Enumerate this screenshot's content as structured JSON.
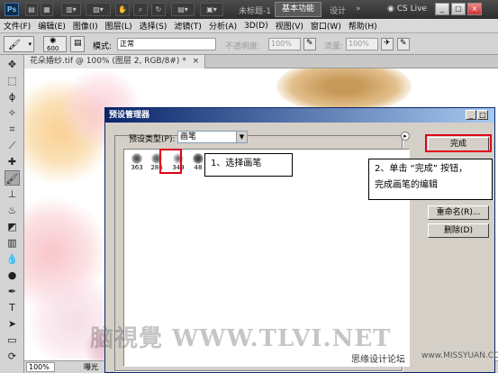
{
  "titlebar": {
    "logo": "Ps",
    "doc_title": "未标题-1",
    "workspace": "基本功能",
    "design": "设计",
    "more": "»",
    "cs_live": "CS Live",
    "minimize": "_",
    "restore": "□",
    "close": "×"
  },
  "menu": {
    "items": [
      "文件(F)",
      "编辑(E)",
      "图像(I)",
      "图层(L)",
      "选择(S)",
      "滤镜(T)",
      "分析(A)",
      "3D(D)",
      "视图(V)",
      "窗口(W)",
      "帮助(H)"
    ]
  },
  "options": {
    "brush_size": "600",
    "mode_label": "模式:",
    "mode_value": "正常",
    "opacity_label": "不透明度:",
    "opacity_value": "100%",
    "flow_label": "流量:",
    "flow_value": "100%"
  },
  "document": {
    "tab_label": "花朵婚纱.tif @ 100% (图层 2, RGB/8#) *",
    "zoom": "100%",
    "status": "曝光"
  },
  "dialog": {
    "title": "预设管理器",
    "preset_type_label": "预设类型(P):",
    "preset_type_value": "画笔",
    "buttons": {
      "done": "完成",
      "rename": "重命名(R)...",
      "delete": "删除(D)"
    },
    "brushes": [
      {
        "size": "363"
      },
      {
        "size": "286"
      },
      {
        "size": "349"
      },
      {
        "size": "48"
      }
    ]
  },
  "annotations": {
    "step1": "1、选择画笔",
    "step2_line1": "2、单击 “完成” 按钮，",
    "step2_line2": "完成画笔的编辑"
  },
  "watermarks": {
    "tlvi": "脑視覺 WWW.TLVI.NET",
    "forum": "思缘设计论坛",
    "missyuan": "www.MISSYUAN.COM"
  },
  "colors": {
    "highlight": "#e0001b",
    "dialog_title": "#0a246a"
  }
}
